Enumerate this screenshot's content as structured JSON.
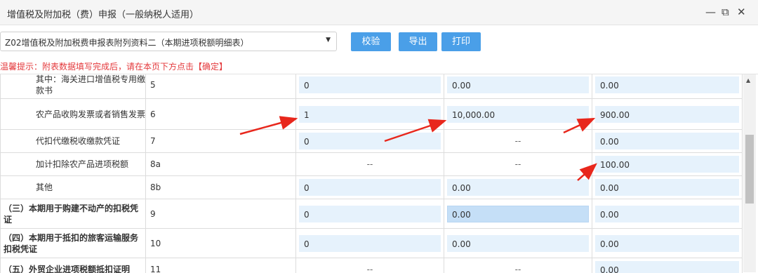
{
  "window": {
    "title": "增值税及附加税（费）申报（一般纳税人适用）",
    "minimize_glyph": "—",
    "maximize_glyph": "⧉",
    "close_glyph": "✕"
  },
  "toolbar": {
    "form_select_value": "Z02增值税及附加税费申报表附列资料二（本期进项税额明细表）",
    "validate_label": "校验",
    "export_label": "导出",
    "print_label": "打印"
  },
  "tip": "温馨提示：附表数据填写完成后，请在本页下方点击【确定】",
  "rows": [
    {
      "name": "其中：海关进口增值税专用缴款书",
      "line": "5",
      "c1": "0",
      "c2": "0.00",
      "c3": "0.00"
    },
    {
      "name": "农产品收购发票或者销售发票",
      "line": "6",
      "c1": "1",
      "c2": "10,000.00",
      "c3": "900.00"
    },
    {
      "name": "代扣代缴税收缴款凭证",
      "line": "7",
      "c1": "0",
      "c2": "--",
      "c3": "0.00"
    },
    {
      "name": "加计扣除农产品进项税额",
      "line": "8a",
      "c1": "--",
      "c2": "--",
      "c3": "100.00"
    },
    {
      "name": "其他",
      "line": "8b",
      "c1": "0",
      "c2": "0.00",
      "c3": "0.00"
    },
    {
      "name": "（三）本期用于购建不动产的扣税凭证",
      "line": "9",
      "c1": "0",
      "c2": "0.00",
      "c3": "0.00"
    },
    {
      "name": "（四）本期用于抵扣的旅客运输服务扣税凭证",
      "line": "10",
      "c1": "0",
      "c2": "0.00",
      "c3": "0.00"
    },
    {
      "name": "（五）外贸企业进项税额抵扣证明",
      "line": "11",
      "c1": "--",
      "c2": "--",
      "c3": "0.00"
    }
  ],
  "colors": {
    "accent": "#4a9fe8",
    "warning": "#e4393c",
    "annotation": "#e8271c",
    "input_bg": "#e6f2fc"
  }
}
